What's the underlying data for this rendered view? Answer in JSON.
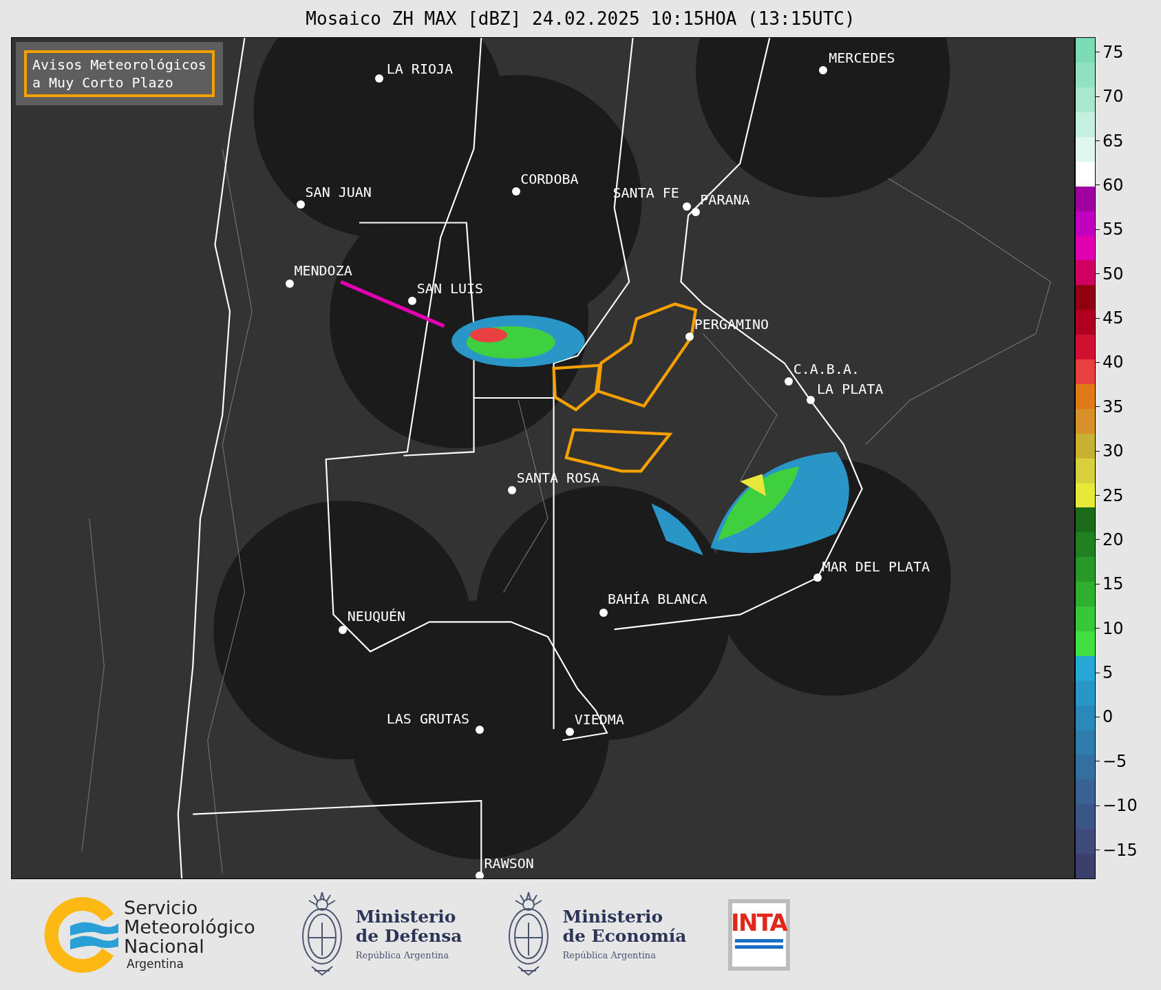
{
  "title": "Mosaico ZH MAX [dBZ] 24.02.2025 10:15HOA (13:15UTC)",
  "legend_box": {
    "lines": [
      "Avisos Meteorológicos",
      "a Muy Corto Plazo"
    ]
  },
  "cities": [
    {
      "name": "LA RIOJA"
    },
    {
      "name": "MERCEDES"
    },
    {
      "name": "CORDOBA"
    },
    {
      "name": "SAN JUAN"
    },
    {
      "name": "SANTA FE"
    },
    {
      "name": "PARANA"
    },
    {
      "name": "MENDOZA"
    },
    {
      "name": "SAN LUIS"
    },
    {
      "name": "PERGAMINO"
    },
    {
      "name": "C.A.B.A."
    },
    {
      "name": "LA PLATA"
    },
    {
      "name": "SANTA ROSA"
    },
    {
      "name": "MAR DEL PLATA"
    },
    {
      "name": "BAHÍA BLANCA"
    },
    {
      "name": "NEUQUÉN"
    },
    {
      "name": "LAS GRUTAS"
    },
    {
      "name": "VIEDMA"
    },
    {
      "name": "RAWSON"
    }
  ],
  "colorbar": {
    "ticks": [
      "75",
      "70",
      "65",
      "60",
      "55",
      "50",
      "45",
      "40",
      "35",
      "30",
      "25",
      "20",
      "15",
      "10",
      "5",
      "0",
      "−5",
      "−10",
      "−15"
    ]
  },
  "footer": {
    "logos": [
      {
        "kind": "smn",
        "lines": [
          "Servicio",
          "Meteorológico",
          "Nacional"
        ],
        "subtitle": "Argentina"
      },
      {
        "kind": "ministry",
        "lines": [
          "Ministerio",
          "de Defensa"
        ],
        "subtitle": "República Argentina"
      },
      {
        "kind": "ministry",
        "lines": [
          "Ministerio",
          "de Economía"
        ],
        "subtitle": "República Argentina"
      },
      {
        "kind": "inta",
        "lines": [
          "INTA"
        ]
      }
    ]
  }
}
